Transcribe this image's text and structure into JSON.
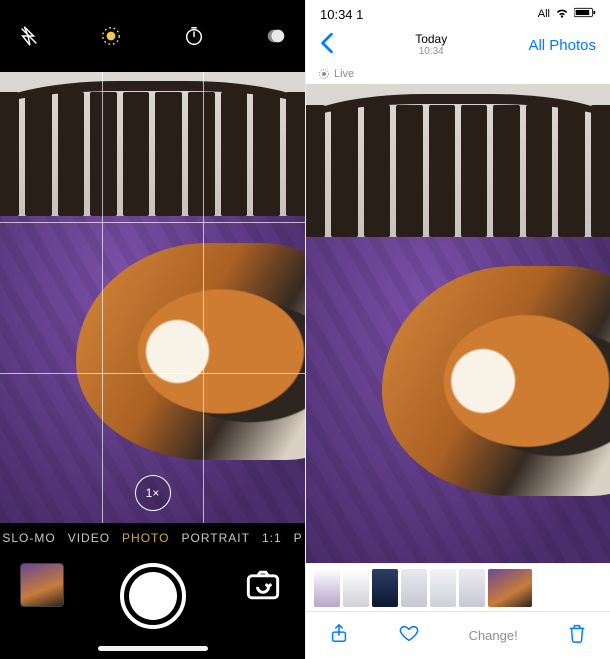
{
  "camera": {
    "zoom_label": "1×",
    "modes": {
      "items": [
        "SLO-MO",
        "VIDEO",
        "PHOTO",
        "PORTRAIT",
        "1:1"
      ],
      "more_indicator": "P",
      "selected": "PHOTO"
    },
    "icons": {
      "flash": "flash-off-icon",
      "live": "live-photo-icon",
      "timer": "timer-icon",
      "filters": "filters-icon",
      "flip": "camera-flip-icon"
    }
  },
  "photos": {
    "status": {
      "time": "10:34 1",
      "signal_label": "All"
    },
    "nav": {
      "title": "Today",
      "subtitle": "10:34",
      "all_photos": "All Photos"
    },
    "live_badge": "Live",
    "toolbar": {
      "change_label": "Change!"
    }
  }
}
